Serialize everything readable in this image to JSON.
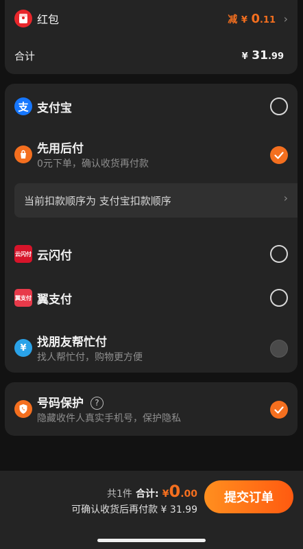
{
  "summary": {
    "redpacket_label": "红包",
    "redpacket_prefix": "减",
    "redpacket_currency": "¥",
    "redpacket_int": "0",
    "redpacket_dec": ".11",
    "total_label": "合计",
    "total_currency": "¥",
    "total_int": "31",
    "total_dec": ".99"
  },
  "payment": {
    "alipay": {
      "title": "支付宝"
    },
    "later": {
      "title": "先用后付",
      "subtitle": "0元下单，确认收货再付款"
    },
    "order_note": "当前扣款顺序为 支付宝扣款顺序",
    "unionpay": {
      "title": "云闪付",
      "logo_text": "云闪付"
    },
    "yipay": {
      "title": "翼支付",
      "logo_text": "翼支付"
    },
    "friend": {
      "title": "找朋友帮忙付",
      "subtitle": "找人帮忙付，购物更方便"
    }
  },
  "protection": {
    "title": "号码保护",
    "help": "?",
    "subtitle": "隐藏收件人真实手机号，保护隐私"
  },
  "footer": {
    "count": "共1件",
    "total_label": "合计:",
    "currency": "¥",
    "amount_int": "0",
    "amount_dec": ".00",
    "note": "可确认收货后再付款 ¥ 31.99",
    "submit": "提交订单"
  },
  "colors": {
    "accent": "#f46f1f",
    "card": "#242424",
    "background": "#121212"
  }
}
